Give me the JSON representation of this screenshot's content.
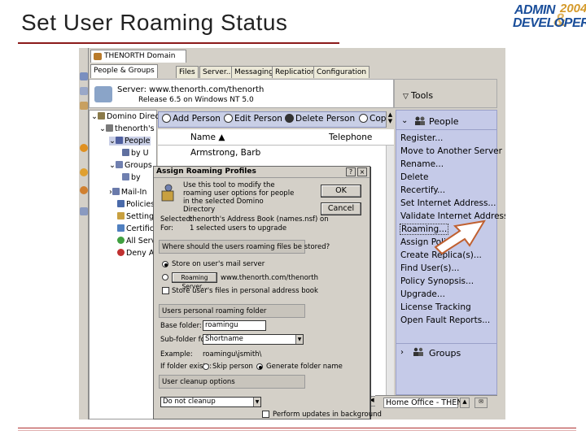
{
  "slide": {
    "title": "Set User Roaming Status",
    "logo": {
      "line1": "ADMIN",
      "line2": "DEVELOPER",
      "year": "2004",
      "amp": "&"
    }
  },
  "window": {
    "doc_tab": "THENORTH Domain",
    "tabs": [
      "People & Groups",
      "Files",
      "Server...",
      "Messaging...",
      "Replication",
      "Configuration"
    ],
    "server_line": "Server: www.thenorth.com/thenorth",
    "release_line": "Release 6.5 on Windows NT 5.0",
    "tools_label": "Tools"
  },
  "tree": {
    "items": [
      "Domino Direc",
      "thenorth's",
      "People",
      "by U",
      "Groups",
      "by",
      "Mail-In",
      "Policies",
      "Settings",
      "Certific",
      "All Serv",
      "Deny Ac"
    ]
  },
  "actions": {
    "add_person": "Add Person",
    "edit_person": "Edit Person",
    "delete_person": "Delete Person",
    "copy": "Cop"
  },
  "view": {
    "col_name": "Name ▲",
    "col_phone": "Telephone",
    "row1_name": "Armstrong, Barb"
  },
  "people_panel": {
    "header": "People",
    "items": [
      "Register...",
      "Move to Another Server",
      "Rename...",
      "Delete",
      "Recertify...",
      "Set Internet Address...",
      "Validate Internet Address",
      "Roaming...",
      "Assign Policy",
      "Create Replica(s)...",
      "Find User(s)...",
      "Policy Synopsis...",
      "Upgrade...",
      "License Tracking",
      "Open Fault Reports..."
    ],
    "groups_label": "Groups"
  },
  "dialog": {
    "title": "Assign Roaming Profiles",
    "description": "Use this tool to modify the roaming user options for people in the selected Domino Directory",
    "ok": "OK",
    "cancel": "Cancel",
    "selected_label": "Selected:",
    "selected_value": "thenorth's Address Book (names.nsf) on",
    "for_label": "For:",
    "for_value": "1 selected users to upgrade",
    "q_location": "Where should the users roaming files be stored?",
    "opt_server": "Store on user's mail server",
    "roaming_server_btn": "Roaming Server...",
    "roaming_server_value": "www.thenorth.com/thenorth",
    "opt_personal": "Store user's files in personal address book",
    "folder_section": "Users personal roaming folder",
    "base_folder_label": "Base folder:",
    "base_folder_value": "roamingu",
    "subfolder_label": "Sub-folder format:",
    "subfolder_value": "Shortname",
    "example_label": "Example:",
    "example_value": "roamingu\\jsmith\\",
    "if_folder_label": "If folder exists:",
    "opt_skip": "Skip person",
    "opt_generate": "Generate folder name",
    "cleanup_section": "User cleanup options",
    "cleanup_value": "Do not cleanup",
    "background_label": "Perform updates in background"
  },
  "status": {
    "location": "Home Office - THEN..."
  }
}
